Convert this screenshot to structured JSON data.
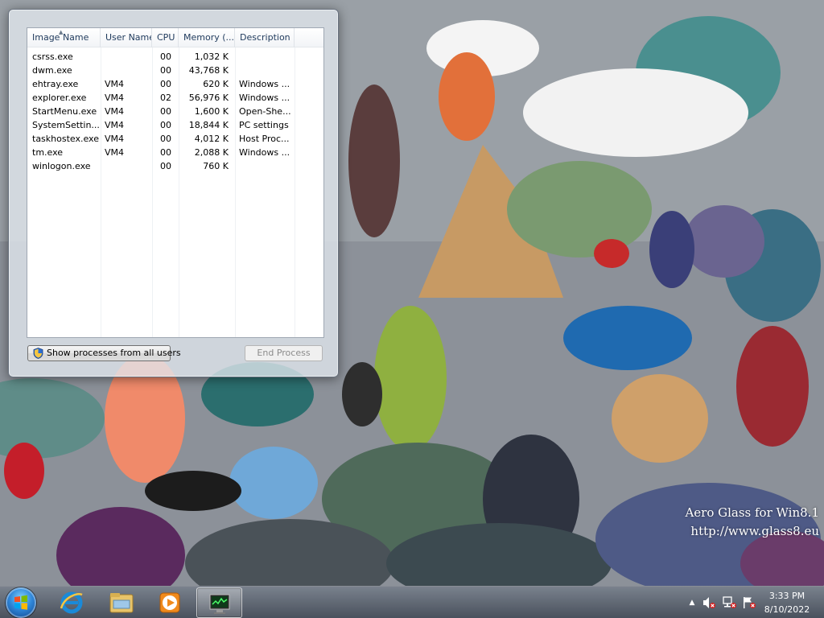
{
  "desktop": {
    "watermark_title": "Aero Glass for Win8.1",
    "watermark_url": "http://www.glass8.eu"
  },
  "task_manager": {
    "columns": [
      "Image Name",
      "User Name",
      "CPU",
      "Memory (...",
      "Description"
    ],
    "sorted_column": "Image Name",
    "processes": [
      {
        "name": "csrss.exe",
        "user": "",
        "cpu": "00",
        "memory": "1,032 K",
        "description": ""
      },
      {
        "name": "dwm.exe",
        "user": "",
        "cpu": "00",
        "memory": "43,768 K",
        "description": ""
      },
      {
        "name": "ehtray.exe",
        "user": "VM4",
        "cpu": "00",
        "memory": "620 K",
        "description": "Windows ..."
      },
      {
        "name": "explorer.exe",
        "user": "VM4",
        "cpu": "02",
        "memory": "56,976 K",
        "description": "Windows ..."
      },
      {
        "name": "StartMenu.exe",
        "user": "VM4",
        "cpu": "00",
        "memory": "1,600 K",
        "description": "Open-She..."
      },
      {
        "name": "SystemSettin...",
        "user": "VM4",
        "cpu": "00",
        "memory": "18,844 K",
        "description": "PC settings"
      },
      {
        "name": "taskhostex.exe",
        "user": "VM4",
        "cpu": "00",
        "memory": "4,012 K",
        "description": "Host Proc..."
      },
      {
        "name": "tm.exe",
        "user": "VM4",
        "cpu": "00",
        "memory": "2,088 K",
        "description": "Windows ..."
      },
      {
        "name": "winlogon.exe",
        "user": "",
        "cpu": "00",
        "memory": "760 K",
        "description": ""
      }
    ],
    "show_all_button": "Show processes from all users",
    "end_process_button": "End Process",
    "end_process_enabled": false
  },
  "taskbar": {
    "pinned": [
      "internet-explorer-icon",
      "file-explorer-icon",
      "media-player-icon",
      "task-manager-icon"
    ],
    "active": "task-manager-icon",
    "tray_icons": [
      "show-hidden-icons-arrow",
      "volume-muted-icon",
      "network-disconnected-icon",
      "action-center-flag-icon"
    ],
    "tray_arrow": "▲",
    "clock_time": "3:33 PM",
    "clock_date": "8/10/2022"
  },
  "colors": {
    "header_text": "#1e395b",
    "glass": "#e2e8ee",
    "taskbar": "#5a626e"
  }
}
